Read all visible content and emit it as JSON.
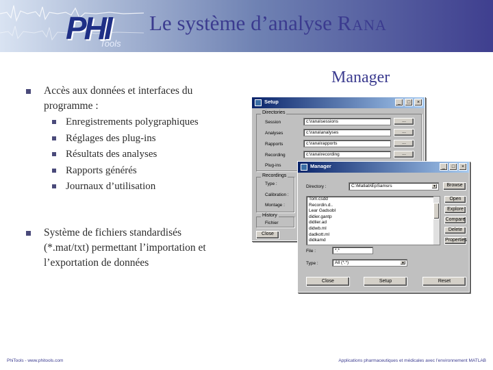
{
  "slide": {
    "title_main": "Le système d’analyse ",
    "title_rana": "Rana",
    "logo": {
      "brand": "PHI",
      "sub": "Tools"
    },
    "bullet1": "Accès aux données et interfaces du programme :",
    "sub_items": [
      "Enregistrements polygraphiques",
      "Réglages des plug-ins",
      "Résultats des analyses",
      "Rapports générés",
      "Journaux d’utilisation"
    ],
    "bullet2": "Système de fichiers standardisés (*.mat/txt) permettant l’importation et l’exportation de données",
    "manager_label": "Manager",
    "footer_left": "PhiTools - www.phitools.com",
    "footer_right": "Applications pharmaceutiques et médicales avec l’environnement MATLAB",
    "colors": {
      "title": "#3b3b8f",
      "titlebar": "#0a246a",
      "window": "#c0c0c0"
    }
  },
  "setup_window": {
    "title": "Setup",
    "group_directories": "Directories",
    "rows": [
      {
        "label": "Session",
        "value": "c:\\rana\\sessions",
        "button": "..."
      },
      {
        "label": "Analyses",
        "value": "c:\\rana\\analyses",
        "button": "..."
      },
      {
        "label": "Rapports",
        "value": "c:\\rana\\rapports",
        "button": "..."
      },
      {
        "label": "Recording",
        "value": "c:\\rana\\recording",
        "button": "..."
      },
      {
        "label": "Plug-ins",
        "value": "",
        "button": ""
      }
    ],
    "group_recordings": "Recordings",
    "rec_rows": [
      "Type :",
      "Calibration :",
      "Montage :"
    ],
    "group_history": "History",
    "history_row": "Fichier",
    "close_button": "Close"
  },
  "manager_window": {
    "title": "Manager",
    "directory_label": "Directory :",
    "directory_value": "C:\\Matlab\\EpSamsrs",
    "browse_button": "Browse",
    "files": [
      "Tom.csdd",
      "Recordin.d..",
      "Lear Gadsobl",
      "didier.gantp",
      "didlier.ad",
      "didwb.ml",
      "dadkott.ml",
      "didkamd"
    ],
    "side_buttons": [
      "Open",
      "Explore",
      "Compare",
      "Delete",
      "Properties"
    ],
    "file_label": "File :",
    "file_value": "*.*",
    "type_label": "Type :",
    "type_value": "All (*.*)",
    "bottom_buttons": [
      "Close",
      "Setup",
      "Reset"
    ]
  }
}
